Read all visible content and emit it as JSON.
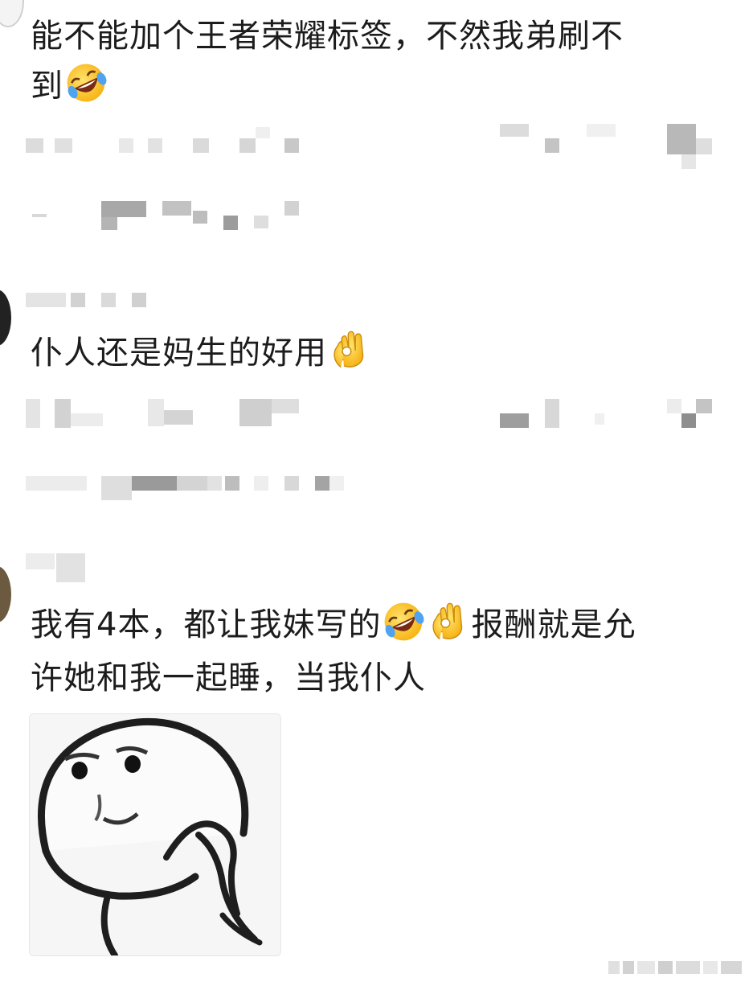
{
  "comments": [
    {
      "line1": "能不能加个王者荣耀标签，不然我弟刷不",
      "line2": "到",
      "emojis": [
        "rolling-laughing-emoji"
      ]
    },
    {
      "text": "仆人还是妈生的好用",
      "emojis": [
        "ok-hand-emoji"
      ]
    },
    {
      "line1a": "我有4本，都让我妹写的",
      "line1b": "报酬就是允",
      "line2": "许她和我一起睡，当我仆人",
      "emojis": [
        "rolling-laughing-emoji",
        "ok-hand-emoji"
      ]
    }
  ],
  "colors": {
    "text": "#1c1c1c",
    "pixelate_light": "#e4e4e4",
    "pixelate_dark": "#8a8a8a",
    "emoji_yellow": "#fbc02d"
  }
}
